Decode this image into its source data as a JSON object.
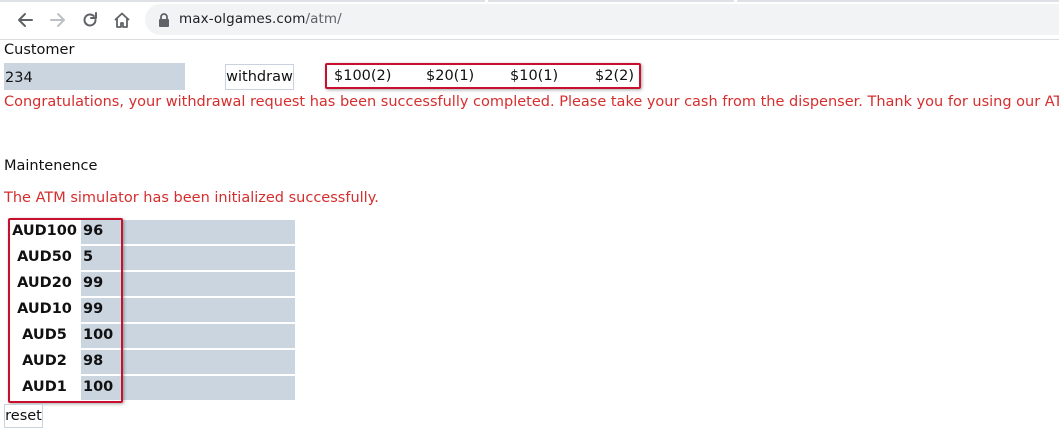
{
  "browser": {
    "url_host": "max-olgames.com",
    "url_path": "/atm/"
  },
  "customer": {
    "title": "Customer",
    "amount_value": "234",
    "withdraw_label": "withdraw",
    "notes": [
      {
        "label": "$100(2)"
      },
      {
        "label": "$20(1)"
      },
      {
        "label": "$10(1)"
      },
      {
        "label": "$2(2)"
      }
    ],
    "message": "Congratulations, your withdrawal request has been successfully completed. Please take your cash from the dispenser. Thank you for using our ATM."
  },
  "maintenance": {
    "title": "Maintenence",
    "message": "The ATM simulator has been initialized successfully.",
    "denominations": [
      {
        "label": "AUD100",
        "value": "96"
      },
      {
        "label": "AUD50",
        "value": "5"
      },
      {
        "label": "AUD20",
        "value": "99"
      },
      {
        "label": "AUD10",
        "value": "99"
      },
      {
        "label": "AUD5",
        "value": "100"
      },
      {
        "label": "AUD2",
        "value": "98"
      },
      {
        "label": "AUD1",
        "value": "100"
      }
    ],
    "reset_label": "reset"
  },
  "colors": {
    "message_red": "#d62e2e",
    "highlight_box": "#c8102e",
    "input_bg": "#cbd5e0"
  }
}
